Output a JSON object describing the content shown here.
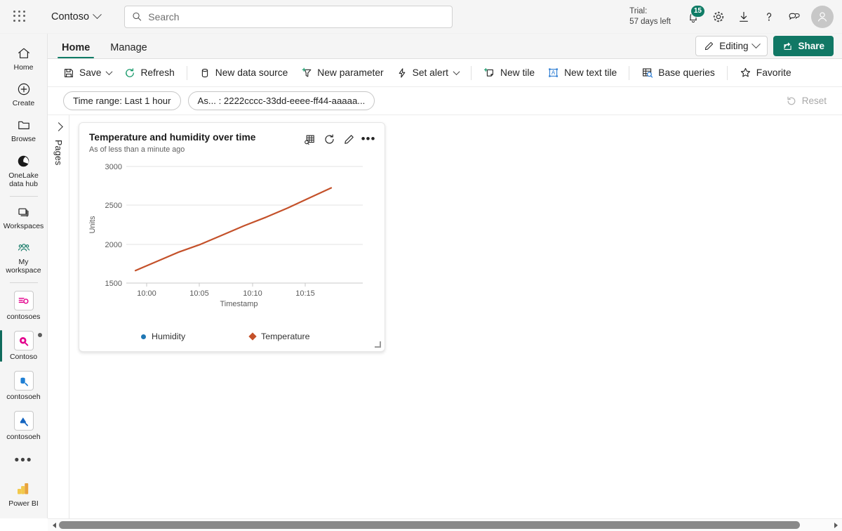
{
  "header": {
    "waffle_label": "app-launcher",
    "brand": "Contoso",
    "search_placeholder": "Search",
    "search_value": "",
    "trial_line1": "Trial:",
    "trial_line2": "57 days left",
    "notification_count": "15",
    "icons": [
      "notification-bell-icon",
      "gear-icon",
      "download-icon",
      "help-icon",
      "feedback-icon",
      "avatar"
    ]
  },
  "sidebar": {
    "items": [
      {
        "label": "Home",
        "icon": "home-icon"
      },
      {
        "label": "Create",
        "icon": "plus-circle-icon"
      },
      {
        "label": "Browse",
        "icon": "folder-icon"
      },
      {
        "label": "OneLake\ndata hub",
        "icon": "onelake-icon"
      },
      {
        "label": "Workspaces",
        "icon": "workspaces-icon"
      },
      {
        "label": "My\nworkspace",
        "icon": "my-workspace-icon"
      }
    ],
    "workspaces": [
      {
        "label": "contosoes",
        "color": "#e3008c",
        "selected": false
      },
      {
        "label": "Contoso",
        "color": "#e3008c",
        "selected": true
      },
      {
        "label": "contosoeh",
        "color": "#1f7fd4",
        "selected": false
      },
      {
        "label": "contosoeh",
        "color": "#1565c0",
        "selected": false
      }
    ],
    "more_label": "•••",
    "footer": {
      "label": "Power BI",
      "icon": "power-bi-icon"
    }
  },
  "tabs": {
    "items": [
      {
        "label": "Home",
        "active": true
      },
      {
        "label": "Manage",
        "active": false
      }
    ],
    "editing_label": "Editing",
    "share_label": "Share"
  },
  "toolbar": {
    "commands": [
      {
        "label": "Save",
        "icon": "save-icon",
        "caret": true
      },
      {
        "label": "Refresh",
        "icon": "refresh-icon",
        "caret": false
      },
      {
        "label": "New data source",
        "icon": "database-icon",
        "caret": false
      },
      {
        "label": "New parameter",
        "icon": "new-parameter-icon",
        "caret": false
      },
      {
        "label": "Set alert",
        "icon": "alert-bolt-icon",
        "caret": true
      },
      {
        "label": "New tile",
        "icon": "new-tile-icon",
        "caret": false
      },
      {
        "label": "New text tile",
        "icon": "new-text-tile-icon",
        "caret": false
      },
      {
        "label": "Base queries",
        "icon": "base-queries-icon",
        "caret": false
      },
      {
        "label": "Favorite",
        "icon": "star-icon",
        "caret": false
      }
    ]
  },
  "filterbar": {
    "pills": [
      {
        "label": "Time range: Last 1 hour"
      },
      {
        "label": "As... : 2222cccc-33dd-eeee-ff44-aaaaa..."
      }
    ],
    "reset_label": "Reset"
  },
  "pages_panel": {
    "label": "Pages",
    "expander_icon": "chevron-right-icon"
  },
  "tile": {
    "title": "Temperature and humidity over time",
    "subtitle": "As of less than a minute ago",
    "actions": [
      "table-view-icon",
      "refresh-icon",
      "edit-pencil-icon",
      "more-options-icon"
    ]
  },
  "chart_data": {
    "type": "line",
    "title": "Temperature and humidity over time",
    "xlabel": "Timestamp",
    "ylabel": "Units",
    "xticks": [
      "10:00",
      "10:05",
      "10:10",
      "10:15"
    ],
    "yticks": [
      1500,
      2000,
      2500,
      3000
    ],
    "ylim": [
      1500,
      3000
    ],
    "grid": true,
    "legend_position": "bottom",
    "series": [
      {
        "name": "Humidity",
        "color": "#1f77b4",
        "marker": "circle",
        "x": [],
        "values": []
      },
      {
        "name": "Temperature",
        "color": "#c4512a",
        "marker": "diamond",
        "x": [
          "09:59",
          "10:01",
          "10:03",
          "10:05",
          "10:07",
          "10:09",
          "10:11",
          "10:13",
          "10:15",
          "10:17"
        ],
        "values": [
          1660,
          1780,
          1900,
          2000,
          2120,
          2240,
          2350,
          2470,
          2600,
          2730
        ]
      }
    ]
  },
  "scrollbar": {
    "thumb_percent": 96
  }
}
